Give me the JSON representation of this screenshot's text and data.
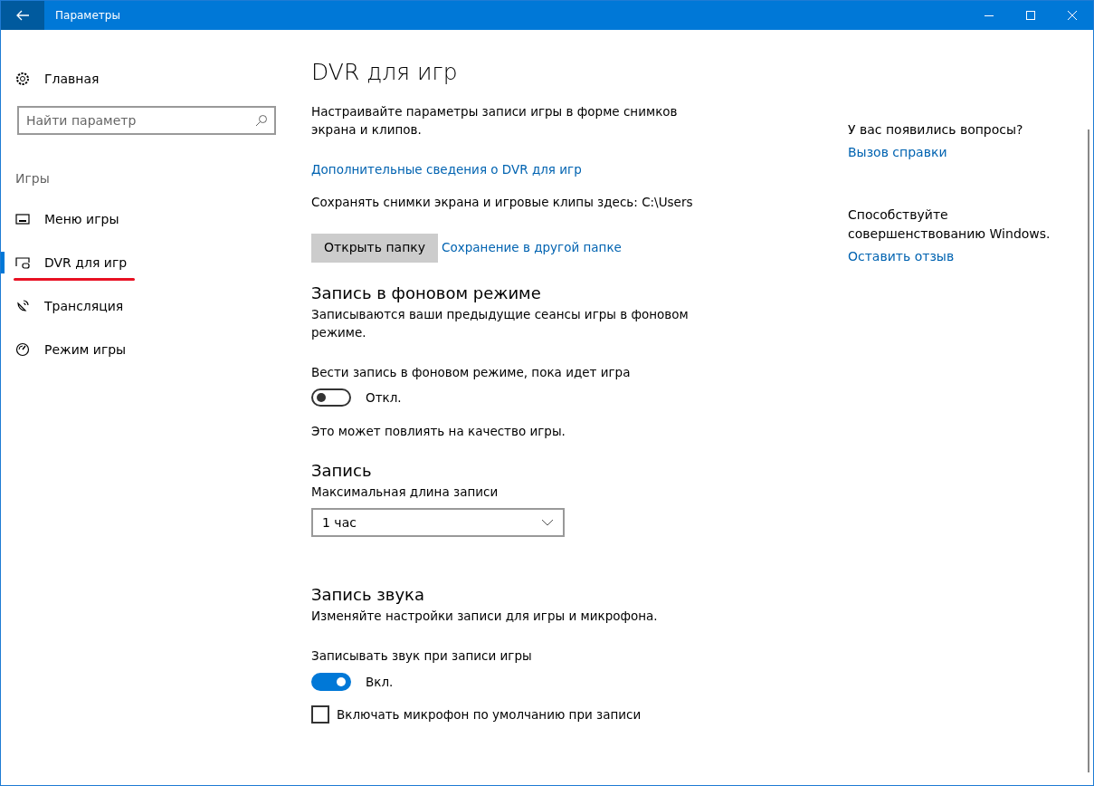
{
  "window": {
    "title": "Параметры"
  },
  "sidebar": {
    "home": "Главная",
    "search": {
      "placeholder": "Найти параметр"
    },
    "section": "Игры",
    "items": [
      {
        "label": "Меню игры",
        "selected": false,
        "underlined": false
      },
      {
        "label": "DVR для игр",
        "selected": true,
        "underlined": true
      },
      {
        "label": "Трансляция",
        "selected": false,
        "underlined": false
      },
      {
        "label": "Режим игры",
        "selected": false,
        "underlined": false
      }
    ]
  },
  "main": {
    "title": "DVR для игр",
    "intro": "Настраивайте параметры записи игры в форме снимков экрана и клипов.",
    "more_link": "Дополнительные сведения о DVR для игр",
    "save_path": "Сохранять снимки экрана и игровые клипы здесь: C:\\Users",
    "open_button": "Открыть папку",
    "other_folder_link": "Сохранение в другой папке",
    "sections": [
      {
        "heading": "Запись в фоновом режиме",
        "description": "Записываются ваши предыдущие сеансы игры в фоновом режиме.",
        "controls": [
          {
            "kind": "toggle",
            "label": "Вести запись в фоновом режиме, пока идет игра",
            "on": false,
            "state_text": "Откл."
          },
          {
            "kind": "note",
            "text": "Это может повлиять на качество игры."
          }
        ]
      },
      {
        "heading": "Запись",
        "controls": [
          {
            "kind": "dropdown",
            "label": "Максимальная длина записи",
            "value": "1 час"
          }
        ]
      },
      {
        "heading": "Запись звука",
        "description": "Изменяйте настройки записи для игры и микрофона.",
        "controls": [
          {
            "kind": "toggle",
            "label": "Записывать звук при записи игры",
            "on": true,
            "state_text": "Вкл."
          },
          {
            "kind": "checkbox",
            "label": "Включать микрофон по умолчанию при записи",
            "checked": false
          }
        ]
      }
    ]
  },
  "aside": {
    "help_question": "У вас появились вопросы?",
    "help_link": "Вызов справки",
    "feedback_text": "Способствуйте совершенствованию Windows.",
    "feedback_link": "Оставить отзыв"
  }
}
